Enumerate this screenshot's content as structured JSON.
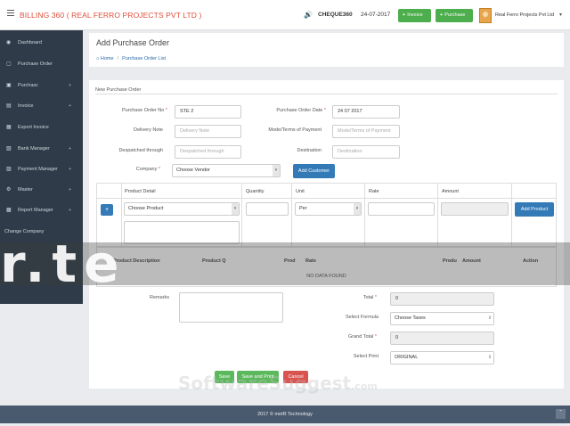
{
  "header": {
    "brand": "BILLING 360 ( REAL FERRO PROJECTS PVT LTD )",
    "cheque_label": "CHEQUE360",
    "date": "24-07-2017",
    "invoice_btn": "Invoice",
    "purchase_btn": "Purchase",
    "user_name": "Real Ferro Projects Pvt Ltd"
  },
  "sidebar": {
    "items": [
      {
        "label": "Dashboard",
        "icon": "dashboard-icon",
        "expand": ""
      },
      {
        "label": "Purchase Order",
        "icon": "cart-icon",
        "expand": ""
      },
      {
        "label": "Purchasc",
        "icon": "shopping-cart-icon",
        "expand": "+"
      },
      {
        "label": "Invoice",
        "icon": "invoice-icon",
        "expand": "+"
      },
      {
        "label": "Export Invoice",
        "icon": "export-icon",
        "expand": ""
      },
      {
        "label": "Bank Manager",
        "icon": "bank-icon",
        "expand": "+"
      },
      {
        "label": "Payment Manager",
        "icon": "payment-icon",
        "expand": "+"
      },
      {
        "label": "Master",
        "icon": "gear-icon",
        "expand": "+"
      },
      {
        "label": "Report Manager",
        "icon": "report-icon",
        "expand": "+"
      },
      {
        "label": "Change Company",
        "icon": "",
        "expand": ""
      }
    ]
  },
  "page": {
    "title": "Add Purchase Order",
    "breadcrumb_home": "Home",
    "breadcrumb_current": "Purchase Order List"
  },
  "form": {
    "section_title": "New Purchase Order",
    "po_no_label": "Purchase Order No",
    "po_no_value": "STE 2",
    "po_date_label": "Purchase Order Date",
    "po_date_value": "24 07 2017",
    "delivery_note_label": "Delivery Note",
    "delivery_note_placeholder": "Delivery Note",
    "mode_label": "Mode/Terms of Payment",
    "mode_placeholder": "Mode/Terms of Payment",
    "despatched_label": "Despatched through",
    "despatched_placeholder": "Despatched through",
    "destination_label": "Destination",
    "destination_placeholder": "Destination",
    "company_label": "Company",
    "company_value": "Choose Vendor",
    "add_customer_btn": "Add Customer"
  },
  "product_grid": {
    "headers": [
      "Product Detail",
      "Quantity",
      "Unit",
      "Rate",
      "Amount"
    ],
    "add_row_btn": "+",
    "product_select": "Choose Product",
    "unit_select": "Per",
    "add_product_btn": "Add Product"
  },
  "product_list": {
    "headers": [
      "Product Description",
      "Product Q",
      "Prod",
      "Rate",
      "Produ",
      "Amount",
      "Action"
    ],
    "empty_text": "NO DATA FOUND"
  },
  "summary": {
    "remarks_label": "Remarks",
    "total_label": "Total",
    "total_value": "0",
    "formula_label": "Select Formula",
    "formula_value": "Choose Taxes",
    "grand_total_label": "Grand Total",
    "grand_total_value": "0",
    "print_label": "Select Print",
    "print_value": "ORIGINAL"
  },
  "actions": {
    "save": "Save",
    "save_print": "Save and Print",
    "cancel": "Cancel"
  },
  "footer": {
    "text": "2017 © metR Technology"
  },
  "watermark": {
    "band_text": "r.te",
    "bottom_text": "SoftwareSuggest",
    "bottom_suffix": ".com"
  },
  "colors": {
    "brand": "#e04e39",
    "sidebar": "#2f3b48",
    "primary": "#337ab7",
    "success": "#5cb85c",
    "danger": "#d9534f"
  }
}
